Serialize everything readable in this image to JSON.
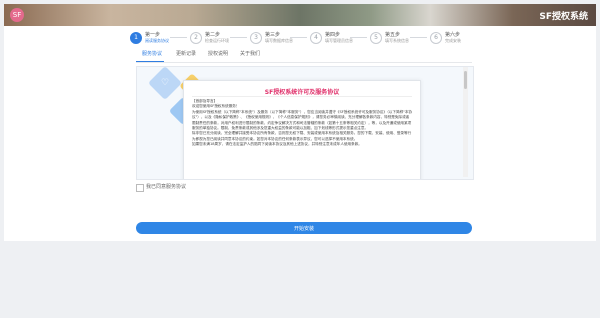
{
  "header": {
    "logo_text": "SF",
    "title": "SF授权系统"
  },
  "steps": [
    {
      "num": "1",
      "title": "第一步",
      "desc": "阅读服务协议"
    },
    {
      "num": "2",
      "title": "第二步",
      "desc": "检查运行环境"
    },
    {
      "num": "3",
      "title": "第三步",
      "desc": "填写数据库信息"
    },
    {
      "num": "4",
      "title": "第四步",
      "desc": "填写管理员信息"
    },
    {
      "num": "5",
      "title": "第五步",
      "desc": "填写系统信息"
    },
    {
      "num": "6",
      "title": "第六步",
      "desc": "完成安装"
    }
  ],
  "tabs": [
    "服务协议",
    "更新记录",
    "授权说明",
    "关于我们"
  ],
  "agreement": {
    "title": "SF授权系统许可及服务协议",
    "paragraphs": [
      "【首部及导言】",
      "欢迎您使用SF授权系统服务！",
      "为使用SF授权系统（以下简称\"本系统\"）及服务（以下简称\"本服务\"），您应当阅读并遵守《SF授权系统许可及服务协议》（以下简称\"本协议\"），以及《隐私保护政策》、《授权使用规则》、《个人信息保护规则》，请您务必审慎阅读、充分理解各条款内容，特别是免除或者限制责任的条款，对用户权利进行限制的条款，约定争议解决方式和司法管辖的条款（如第十五条等相关约定），等，以及开通或使用某项服务的单独协议。限制、免责条款或其他涉及您重大权益的条款可能以加粗、加下划线等形式提示您重点注意。",
      "除非您已充分阅读、完全理解并接受本协议所有条款，否则您无权下载、安装或使用本系统及相关服务。您的下载、安装、使用、登录等行为即视为您已阅读并同意本协议的约束。如您对本协议的任何条款表示异议，您可以选择不使用本系统。",
      "如果您未满18周岁，请在法定监护人的陪同下阅读本协议及其他上述协议，并特别注意未成年人使用条款。"
    ]
  },
  "agree_label": "我已同意服务协议",
  "start_button": "开始安装"
}
